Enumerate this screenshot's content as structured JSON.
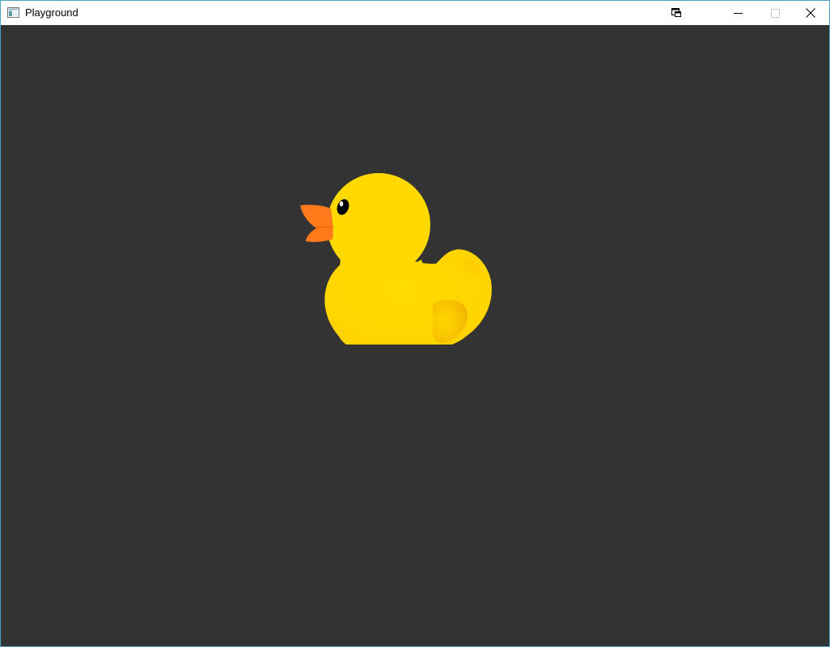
{
  "window": {
    "title": "Playground",
    "background_color": "#333333",
    "titlebar_color": "#ffffff",
    "accent_border_color": "#4aa3c4"
  },
  "titlebar": {
    "app_icon": "application-window-icon",
    "buttons": [
      {
        "icon": "snap-layout-icon"
      },
      {
        "icon": "minimize-icon"
      },
      {
        "icon": "maximize-icon",
        "disabled": true
      },
      {
        "icon": "close-icon"
      }
    ]
  },
  "scene": {
    "object": "rubber-duck",
    "colors": {
      "body": "#ffd400",
      "body_shade": "#f5b800",
      "beak": "#ff7a1a",
      "eye": "#000000"
    }
  }
}
